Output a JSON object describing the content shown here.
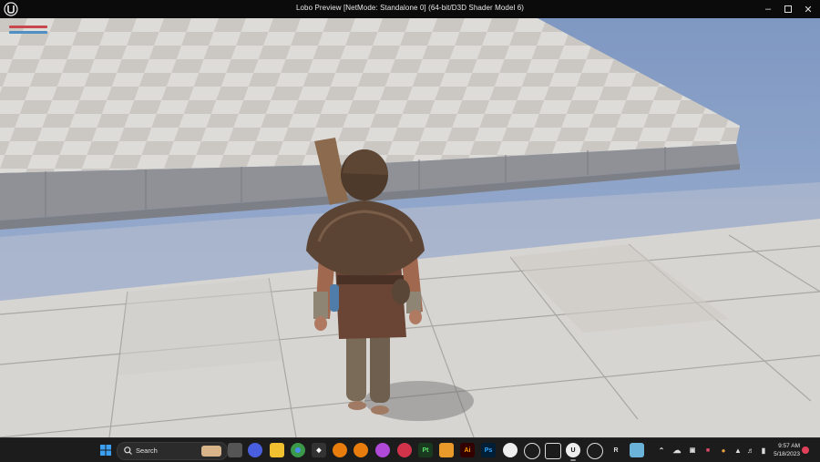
{
  "window": {
    "title": "Lobo Preview [NetMode: Standalone 0]  (64-bit/D3D Shader Model 6)",
    "minimize_icon": "minimize-icon",
    "maximize_icon": "maximize-icon",
    "close_icon": "close-icon"
  },
  "hud": {
    "health_color": "#c8474d",
    "stamina_color": "#4f8fc4"
  },
  "taskbar": {
    "search_label": "Search",
    "pinned_apps": [
      "start-menu-icon",
      "search-icon",
      "task-view-icon",
      "zoom-icon",
      "file-explorer-icon",
      "chrome-icon",
      "unity-icon",
      "blender-icon",
      "blender-icon",
      "krita-icon",
      "davinci-resolve-icon",
      "painter-icon",
      "substance-designer-icon",
      "illustrator-icon",
      "photoshop-icon",
      "obs-icon",
      "app-icon",
      "app-icon",
      "unreal-engine-icon",
      "app-icon",
      "rider-icon",
      "app-icon"
    ],
    "time": "9:57 AM",
    "date": "5/18/2023"
  },
  "colors": {
    "sky": "#8ba2c7",
    "tile_light": "#dcdad6",
    "tile_dark": "#c9c6c1",
    "tile_side": "#8c8e94",
    "taskbar": "#1c1c1c"
  }
}
